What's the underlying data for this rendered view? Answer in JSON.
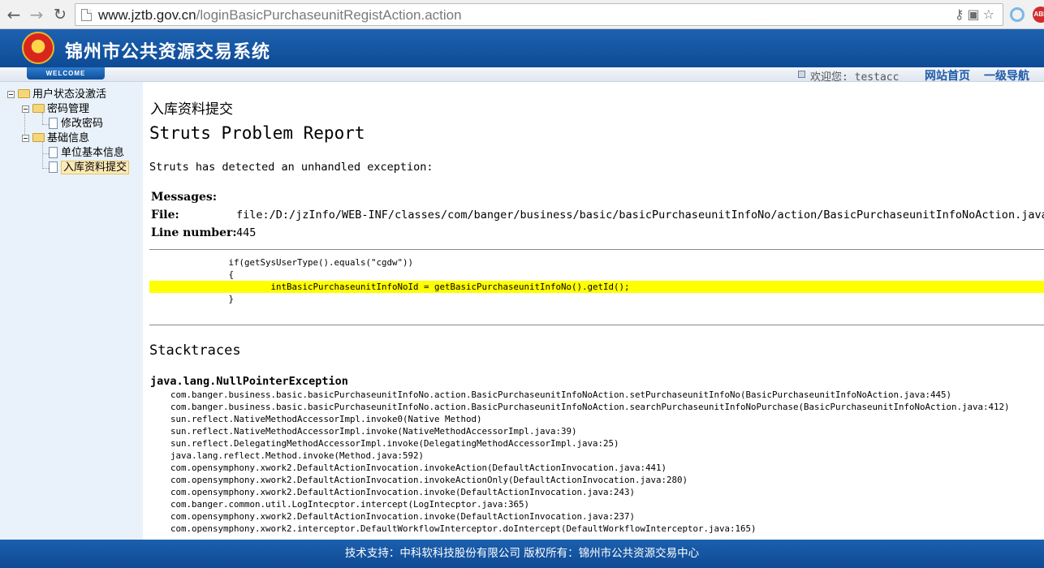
{
  "browser": {
    "url_host": "www.jztb.gov.cn",
    "url_path": "/loginBasicPurchaseunitRegistAction.action"
  },
  "header": {
    "site_title": "锦州市公共资源交易系统",
    "welcome_tab": "WELCOME",
    "greeting": "欢迎您: testacc",
    "links": [
      "网站首页",
      "一级导航"
    ]
  },
  "sidebar": {
    "root": "用户状态没激活",
    "groups": [
      {
        "label": "密码管理",
        "items": [
          "修改密码"
        ]
      },
      {
        "label": "基础信息",
        "items": [
          "单位基本信息",
          "入库资料提交"
        ]
      }
    ],
    "selected": "入库资料提交"
  },
  "main": {
    "heading": "入库资料提交",
    "report_title": "Struts Problem Report",
    "intro": "Struts has detected an unhandled exception:",
    "messages_label": "Messages:",
    "messages_value": "",
    "file_label": "File:",
    "file_value": "file:/D:/jzInfo/WEB-INF/classes/com/banger/business/basic/basicPurchaseunitInfoNo/action/BasicPurchaseunitInfoNoAction.java",
    "line_label": "Line number:",
    "line_value": "445",
    "code_lines": [
      "               if(getSysUserType().equals(\"cgdw\"))",
      "               {",
      "                       intBasicPurchaseunitInfoNoId = getBasicPurchaseunitInfoNo().getId();",
      "               }"
    ],
    "highlight_line_index": 2,
    "stacktraces_title": "Stacktraces",
    "exception": "java.lang.NullPointerException",
    "stack": [
      "com.banger.business.basic.basicPurchaseunitInfoNo.action.BasicPurchaseunitInfoNoAction.setPurchaseunitInfoNo(BasicPurchaseunitInfoNoAction.java:445)",
      "com.banger.business.basic.basicPurchaseunitInfoNo.action.BasicPurchaseunitInfoNoAction.searchPurchaseunitInfoNoPurchase(BasicPurchaseunitInfoNoAction.java:412)",
      "sun.reflect.NativeMethodAccessorImpl.invoke0(Native Method)",
      "sun.reflect.NativeMethodAccessorImpl.invoke(NativeMethodAccessorImpl.java:39)",
      "sun.reflect.DelegatingMethodAccessorImpl.invoke(DelegatingMethodAccessorImpl.java:25)",
      "java.lang.reflect.Method.invoke(Method.java:592)",
      "com.opensymphony.xwork2.DefaultActionInvocation.invokeAction(DefaultActionInvocation.java:441)",
      "com.opensymphony.xwork2.DefaultActionInvocation.invokeActionOnly(DefaultActionInvocation.java:280)",
      "com.opensymphony.xwork2.DefaultActionInvocation.invoke(DefaultActionInvocation.java:243)",
      "com.banger.common.util.LogIntecptor.intercept(LogIntecptor.java:365)",
      "com.opensymphony.xwork2.DefaultActionInvocation.invoke(DefaultActionInvocation.java:237)",
      "com.opensymphony.xwork2.interceptor.DefaultWorkflowInterceptor.doIntercept(DefaultWorkflowInterceptor.java:165)"
    ]
  },
  "footer": {
    "text": "技术支持：中科软科技股份有限公司 版权所有：锦州市公共资源交易中心"
  }
}
